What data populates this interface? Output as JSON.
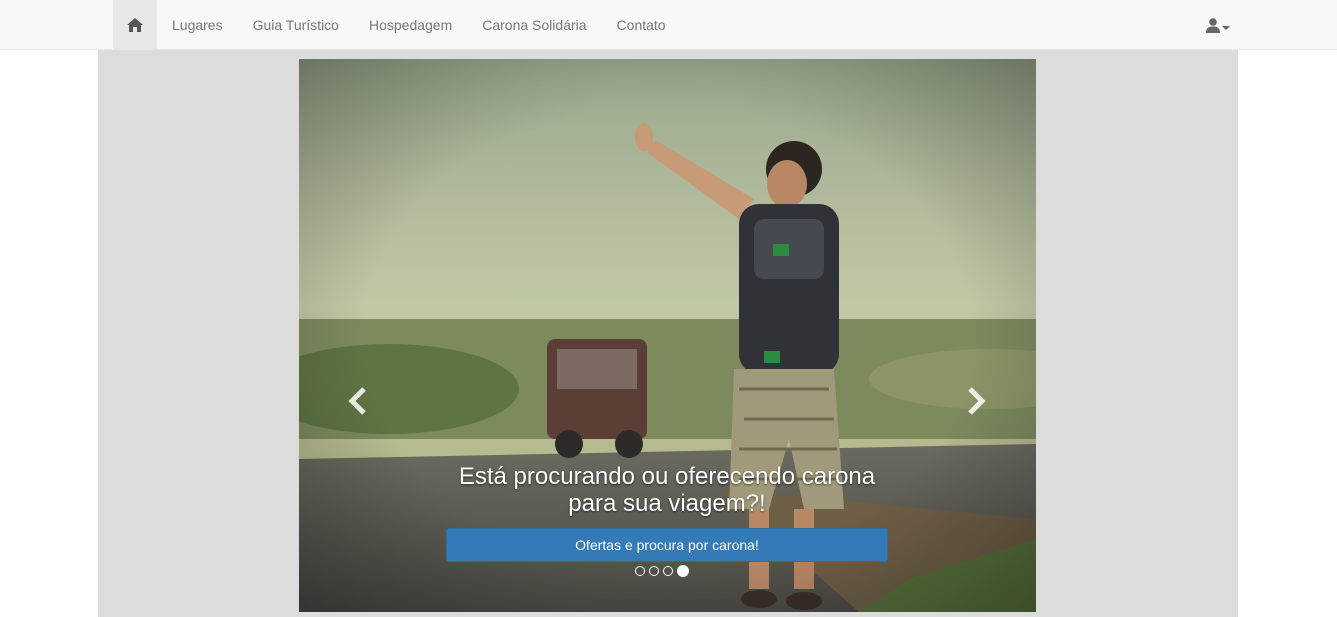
{
  "nav": {
    "home_icon": "home-icon",
    "items": [
      {
        "label": "Lugares"
      },
      {
        "label": "Guia Turístico"
      },
      {
        "label": "Hospedagem"
      },
      {
        "label": "Carona Solidária"
      },
      {
        "label": "Contato"
      }
    ],
    "user_icon": "user-icon"
  },
  "carousel": {
    "caption": "Está procurando ou oferecendo carona para sua viagem?!",
    "cta_label": "Ofertas e procura por carona!",
    "active_slide": 4,
    "slide_count": 4,
    "prev_icon": "chevron-left-icon",
    "next_icon": "chevron-right-icon"
  },
  "colors": {
    "navbar_bg": "#f8f8f8",
    "primary": "#337ab7",
    "jumbotron_bg": "#dcdcdc"
  }
}
